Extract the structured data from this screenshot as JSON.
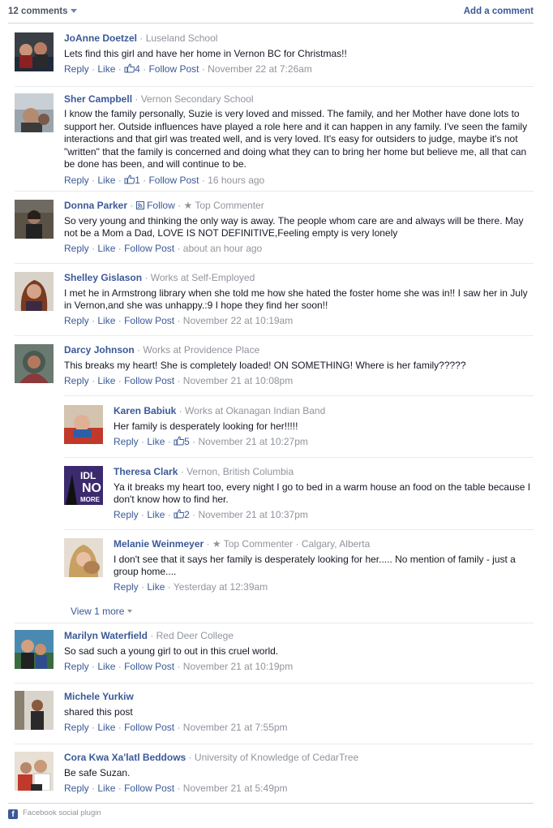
{
  "header": {
    "count_label": "12 comments",
    "add_comment": "Add a comment"
  },
  "actions": {
    "reply": "Reply",
    "like": "Like",
    "follow_post": "Follow Post",
    "dot": "·"
  },
  "comments": [
    {
      "name": "JoAnne Doetzel",
      "meta": "Luseland School",
      "text": "Lets find this girl and have her home in Vernon BC for Christmas!!",
      "likes": "4",
      "time": "November 22 at 7:26am",
      "follow": true
    },
    {
      "name": "Sher Campbell",
      "meta": "Vernon Secondary School",
      "text": "I know the family personally, Suzie is very loved and missed. The family, and her Mother have done lots to support her. Outside influences have played a role here and it can happen in any family. I've seen the family interactions and that girl was treated well, and is very loved. It's easy for outsiders to judge, maybe it's not \"written\" that the family is concerned and doing what they can to bring her home but believe me, all that can be done has been, and will continue to be.",
      "likes": "1",
      "time": "16 hours ago",
      "follow": true
    },
    {
      "name": "Donna Parker",
      "follow_label": "Follow",
      "top_commenter": "Top Commenter",
      "text": "So very young and thinking the only way is away. The people whom care are and always will be there. May not be a Mom a Dad, LOVE IS NOT DEFINITIVE,Feeling empty is very lonely",
      "time": "about an hour ago",
      "follow": true
    },
    {
      "name": "Shelley Gislason",
      "meta_prefix": "Works at",
      "meta_link": "Self-Employed",
      "text": "I met he in Armstrong library when she told me how she hated the foster home she was in!! I saw her in July in Vernon,and she was unhappy.:9 I hope they find her soon!!",
      "time": "November 22 at 10:19am",
      "follow": true
    },
    {
      "name": "Darcy Johnson",
      "meta_prefix": "Works at",
      "meta_link": "Providence Place",
      "text": "This breaks my heart! She is completely loaded! ON SOMETHING! Where is her family?????",
      "time": "November 21 at 10:08pm",
      "follow": true
    },
    {
      "name": "Marilyn Waterfield",
      "meta_link": "Red Deer College",
      "text": "So sad such a young girl to out in this cruel world.",
      "time": "November 21 at 10:19pm",
      "follow": true
    },
    {
      "name": "Michele Yurkiw",
      "text": "shared this post",
      "time": "November 21 at 7:55pm",
      "follow": true
    },
    {
      "name": "Cora Kwa Xa'latl Beddows",
      "meta_link": "University of Knowledge of CedarTree",
      "text": "Be safe Suzan.",
      "time": "November 21 at 5:49pm",
      "follow": true
    }
  ],
  "replies": [
    {
      "name": "Karen Babiuk",
      "meta_prefix": "Works at",
      "meta_link": "Okanagan Indian Band",
      "text": "Her family is desperately looking for her!!!!!",
      "likes": "5",
      "time": "November 21 at 10:27pm"
    },
    {
      "name": "Theresa Clark",
      "meta_link": "Vernon, British Columbia",
      "text": "Ya it breaks my heart too, every night I go to bed in a warm house an food on the table because I don't know how to find her.",
      "likes": "2",
      "time": "November 21 at 10:37pm"
    },
    {
      "name": "Melanie Weinmeyer",
      "top_commenter": "Top Commenter",
      "meta_link": "Calgary, Alberta",
      "text": "I don't see that it says her family is desperately looking for her..... No mention of family - just a group home....",
      "time": "Yesterday at 12:39am"
    }
  ],
  "view_more": "View 1 more",
  "footer": {
    "plugin_label": "Facebook social plugin",
    "icon_letter": "f"
  },
  "colors": {
    "link": "#3b5998",
    "muted": "#90949c",
    "text": "#141823"
  }
}
